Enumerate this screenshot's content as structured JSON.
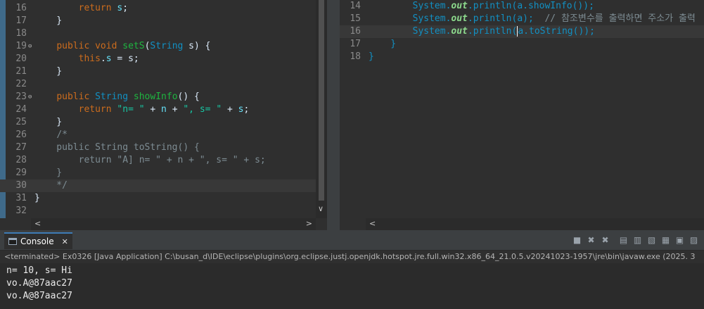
{
  "editor_left": {
    "lines": [
      {
        "num": "16",
        "parts": [
          {
            "t": "        "
          },
          {
            "t": "return",
            "c": "kw"
          },
          {
            "t": " "
          },
          {
            "t": "s",
            "c": "fld"
          },
          {
            "t": ";"
          }
        ]
      },
      {
        "num": "17",
        "parts": [
          {
            "t": "    }"
          }
        ]
      },
      {
        "num": "18",
        "parts": []
      },
      {
        "num": "19",
        "fold": true,
        "parts": [
          {
            "t": "    "
          },
          {
            "t": "public",
            "c": "kw"
          },
          {
            "t": " "
          },
          {
            "t": "void",
            "c": "kw"
          },
          {
            "t": " "
          },
          {
            "t": "setS",
            "c": "mth"
          },
          {
            "t": "("
          },
          {
            "t": "String",
            "c": "typ"
          },
          {
            "t": " s) {"
          }
        ]
      },
      {
        "num": "20",
        "parts": [
          {
            "t": "        "
          },
          {
            "t": "this",
            "c": "kw"
          },
          {
            "t": "."
          },
          {
            "t": "s",
            "c": "fld"
          },
          {
            "t": " = s;"
          }
        ]
      },
      {
        "num": "21",
        "parts": [
          {
            "t": "    }"
          }
        ]
      },
      {
        "num": "22",
        "parts": []
      },
      {
        "num": "23",
        "fold": true,
        "parts": [
          {
            "t": "    "
          },
          {
            "t": "public",
            "c": "kw"
          },
          {
            "t": " "
          },
          {
            "t": "String",
            "c": "typ"
          },
          {
            "t": " "
          },
          {
            "t": "showInfo",
            "c": "mth"
          },
          {
            "t": "() {"
          }
        ]
      },
      {
        "num": "24",
        "parts": [
          {
            "t": "        "
          },
          {
            "t": "return",
            "c": "kw"
          },
          {
            "t": " "
          },
          {
            "t": "\"n= \"",
            "c": "str"
          },
          {
            "t": " + "
          },
          {
            "t": "n",
            "c": "fld"
          },
          {
            "t": " + "
          },
          {
            "t": "\", s= \"",
            "c": "str"
          },
          {
            "t": " + "
          },
          {
            "t": "s",
            "c": "fld"
          },
          {
            "t": ";"
          }
        ]
      },
      {
        "num": "25",
        "parts": [
          {
            "t": "    }"
          }
        ]
      },
      {
        "num": "26",
        "parts": [
          {
            "t": "    "
          },
          {
            "t": "/*",
            "c": "cmt"
          }
        ]
      },
      {
        "num": "27",
        "parts": [
          {
            "t": "    public String toString() {",
            "c": "cmt"
          }
        ]
      },
      {
        "num": "28",
        "parts": [
          {
            "t": "        return \"A] n= \" + n + \", s= \" + s;",
            "c": "cmt"
          }
        ]
      },
      {
        "num": "29",
        "parts": [
          {
            "t": "    }",
            "c": "cmt"
          }
        ]
      },
      {
        "num": "30",
        "current": true,
        "parts": [
          {
            "t": "    */",
            "c": "cmt"
          }
        ]
      },
      {
        "num": "31",
        "parts": [
          {
            "t": "}"
          }
        ]
      },
      {
        "num": "32",
        "parts": []
      }
    ]
  },
  "editor_right": {
    "lines": [
      {
        "num": "14",
        "parts": [
          {
            "t": "        System.",
            "c": "typ"
          },
          {
            "t": "out",
            "c": "sout"
          },
          {
            "t": ".println(a.showInfo());",
            "c": "typ"
          }
        ]
      },
      {
        "num": "15",
        "parts": [
          {
            "t": "        System.",
            "c": "typ"
          },
          {
            "t": "out",
            "c": "sout"
          },
          {
            "t": ".println(a);",
            "c": "typ"
          },
          {
            "t": "  "
          },
          {
            "t": "// 참조변수를 출력하면 주소가 출력",
            "c": "cmt"
          }
        ]
      },
      {
        "num": "16",
        "current": true,
        "parts": [
          {
            "t": "        System.",
            "c": "typ"
          },
          {
            "t": "out",
            "c": "sout"
          },
          {
            "t": ".println(",
            "c": "typ"
          },
          {
            "t": "a",
            "c": "typ",
            "cursor": true
          },
          {
            "t": ".toString());",
            "c": "typ"
          }
        ]
      },
      {
        "num": "17",
        "parts": [
          {
            "t": "    }",
            "c": "typ"
          }
        ]
      },
      {
        "num": "18",
        "parts": [
          {
            "t": "}",
            "c": "typ"
          }
        ]
      }
    ]
  },
  "console": {
    "tab_label": "Console",
    "status": "<terminated> Ex0326 [Java Application] C:\\busan_d\\IDE\\eclipse\\plugins\\org.eclipse.justj.openjdk.hotspot.jre.full.win32.x86_64_21.0.5.v20241023-1957\\jre\\bin\\javaw.exe  (2025. 3",
    "output": [
      "n= 10, s= Hi",
      "vo.A@87aac27",
      "vo.A@87aac27"
    ],
    "toolbar": [
      {
        "name": "terminate-icon",
        "glyph": "■"
      },
      {
        "name": "remove-launch-icon",
        "glyph": "✖"
      },
      {
        "name": "remove-all-terminated-icon",
        "glyph": "✖"
      },
      {
        "name": "show-java-heap-icon",
        "glyph": "▤"
      },
      {
        "name": "clear-console-icon",
        "glyph": "▥"
      },
      {
        "name": "scroll-lock-icon",
        "glyph": "▧"
      },
      {
        "name": "word-wrap-icon",
        "glyph": "▦"
      },
      {
        "name": "pin-console-icon",
        "glyph": "▣"
      },
      {
        "name": "display-console-icon",
        "glyph": "▨"
      }
    ]
  }
}
